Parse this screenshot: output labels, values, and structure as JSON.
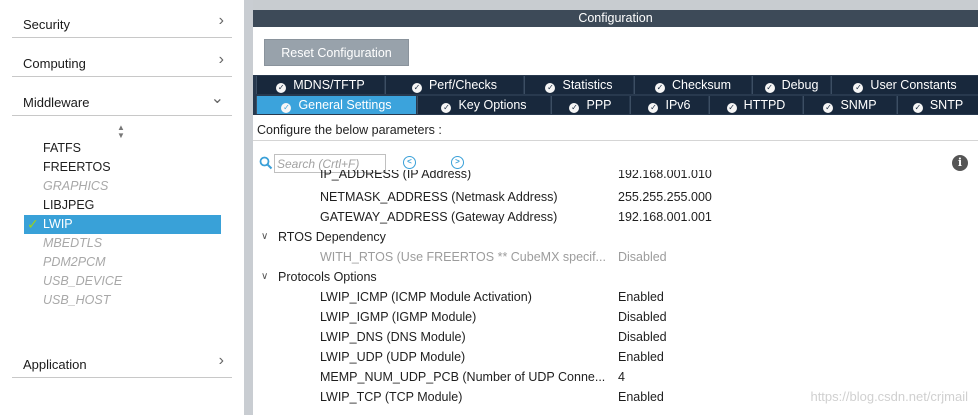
{
  "left_panel": {
    "categories": [
      {
        "label": "Security"
      },
      {
        "label": "Computing"
      },
      {
        "label": "Middleware"
      },
      {
        "label": "Application"
      }
    ],
    "middleware_items": [
      {
        "label": "FATFS",
        "state": "enabled"
      },
      {
        "label": "FREERTOS",
        "state": "enabled"
      },
      {
        "label": "GRAPHICS",
        "state": "disabled"
      },
      {
        "label": "LIBJPEG",
        "state": "enabled"
      },
      {
        "label": "LWIP",
        "state": "selected"
      },
      {
        "label": "MBEDTLS",
        "state": "disabled"
      },
      {
        "label": "PDM2PCM",
        "state": "disabled"
      },
      {
        "label": "USB_DEVICE",
        "state": "disabled"
      },
      {
        "label": "USB_HOST",
        "state": "disabled"
      }
    ]
  },
  "config": {
    "title": "Configuration",
    "reset_label": "Reset Configuration",
    "tabs_row1": [
      "MDNS/TFTP",
      "Perf/Checks",
      "Statistics",
      "Checksum",
      "Debug",
      "User Constants"
    ],
    "tabs_row2": [
      "General Settings",
      "Key Options",
      "PPP",
      "IPv6",
      "HTTPD",
      "SNMP",
      "SNTP"
    ],
    "active_tab": "General Settings",
    "configure_text": "Configure the below parameters :",
    "search_placeholder": "Search (Crtl+F)",
    "params": {
      "clipped_name": "IP_ADDRESS (IP Address)",
      "clipped_value": "192.168.001.010",
      "netmask_name": "NETMASK_ADDRESS (Netmask Address)",
      "netmask_value": "255.255.255.000",
      "gateway_name": "GATEWAY_ADDRESS (Gateway Address)",
      "gateway_value": "192.168.001.001",
      "group_rtos": "RTOS Dependency",
      "with_rtos_name": "WITH_RTOS (Use FREERTOS ** CubeMX specif...",
      "with_rtos_value": "Disabled",
      "group_protocols": "Protocols Options",
      "icmp_name": "LWIP_ICMP (ICMP Module Activation)",
      "icmp_value": "Enabled",
      "igmp_name": "LWIP_IGMP (IGMP Module)",
      "igmp_value": "Disabled",
      "dns_name": "LWIP_DNS (DNS Module)",
      "dns_value": "Disabled",
      "udp_name": "LWIP_UDP (UDP Module)",
      "udp_value": "Enabled",
      "memp_name": "MEMP_NUM_UDP_PCB (Number of UDP Conne...",
      "memp_value": "4",
      "tcp_name": "LWIP_TCP (TCP Module)",
      "tcp_value": "Enabled"
    }
  },
  "watermark": "https://blog.csdn.net/crjmail",
  "colors": {
    "selected_item": "#39a1d8",
    "header_bar": "#3d4a58",
    "tab_bg": "#18283c",
    "active_tab": "#3ba3dc",
    "checkmark": "#9bd21b"
  }
}
